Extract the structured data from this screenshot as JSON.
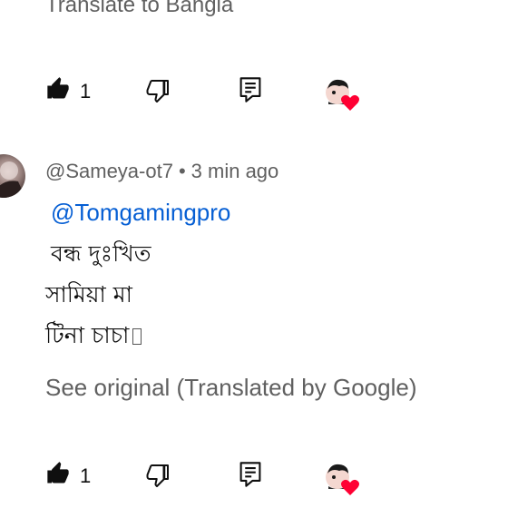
{
  "top_comment": {
    "translate_link": "Translate to Bangla",
    "like_count": "1"
  },
  "comment": {
    "author": "@Sameya-ot7",
    "separator": "•",
    "timestamp": "3 min ago",
    "mention": "@Tomgamingpro",
    "lines": [
      "বন্ধ দুঃখিত",
      "সামিয়া মা",
      "টিনা চাচা"
    ],
    "see_original": "See original (Translated by Google)",
    "like_count": "1"
  },
  "icons": {
    "like": "thumbs-up-icon",
    "dislike": "thumbs-down-icon",
    "reply": "reply-comment-icon",
    "creator_heart": "creator-heart-icon"
  },
  "colors": {
    "link": "#065fd4",
    "secondary_text": "#606060",
    "heart": "#ff0033"
  }
}
